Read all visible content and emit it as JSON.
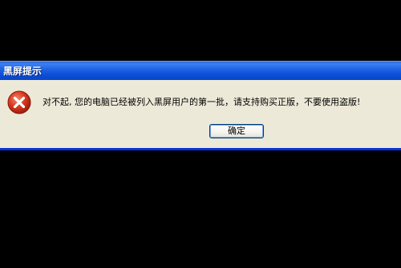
{
  "dialog": {
    "title": "黑屏提示",
    "icon": "error-icon",
    "message": "对不起, 您的电脑已经被列入黑屏用户的第一批，请支持购买正版，不要使用盗版!",
    "ok_label": "确定"
  },
  "colors": {
    "screen_background": "#000000",
    "dialog_background": "#ece9d8",
    "titlebar_blue": "#0b4fd8",
    "error_red": "#d83a1f"
  }
}
